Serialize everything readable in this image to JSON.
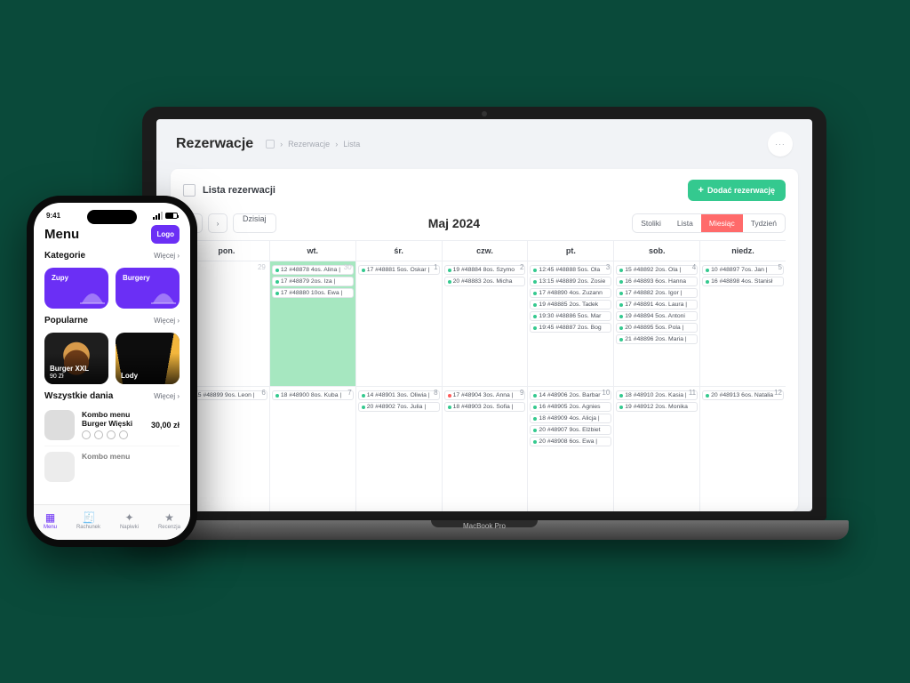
{
  "laptop_label": "MacBook Pro",
  "app": {
    "title": "Rezerwacje",
    "breadcrumbs": [
      "Rezerwacje",
      "Lista"
    ],
    "kebab": "···",
    "panel_title": "Lista rezerwacji",
    "add_button": "Dodać rezerwację",
    "today_button": "Dzisiaj",
    "month_label": "Maj 2024",
    "views": [
      "Stoliki",
      "Lista",
      "Miesiąc",
      "Tydzień"
    ],
    "active_view_index": 2,
    "weekdays": [
      "pon.",
      "wt.",
      "śr.",
      "czw.",
      "pt.",
      "sob.",
      "niedz."
    ],
    "rows": [
      [
        {
          "n": "29",
          "muted": true,
          "today": false,
          "events": []
        },
        {
          "n": "30",
          "muted": true,
          "today": true,
          "events": [
            {
              "t": "12 #48878 4os. Alina |"
            },
            {
              "t": "17 #48879 2os. Iza |"
            },
            {
              "t": "17 #48880 10os. Ewa |"
            }
          ]
        },
        {
          "n": "1",
          "events": [
            {
              "t": "17 #48881 5os. Oskar |"
            }
          ]
        },
        {
          "n": "2",
          "events": [
            {
              "t": "19 #48884 8os. Szymo"
            },
            {
              "t": "20 #48883 2os. Micha"
            }
          ]
        },
        {
          "n": "3",
          "events": [
            {
              "t": "12:45 #48888 5os. Ola"
            },
            {
              "t": "13:15 #48889 2os. Zosie"
            },
            {
              "t": "17 #48890 4os. Zuzann"
            },
            {
              "t": "19 #48885 2os. Tadek"
            },
            {
              "t": "19:30 #48886 5os. Mar"
            },
            {
              "t": "19:45 #48887 2os. Bog"
            }
          ]
        },
        {
          "n": "4",
          "events": [
            {
              "t": "15 #48892 2os. Ola |"
            },
            {
              "t": "16 #48893 6os. Hanna"
            },
            {
              "t": "17 #48882 2os. Igor |"
            },
            {
              "t": "17 #48891 4os. Laura |"
            },
            {
              "t": "19 #48894 5os. Antoni"
            },
            {
              "t": "20 #48895 5os. Pola |"
            },
            {
              "t": "21 #48896 2os. Maria |"
            }
          ]
        },
        {
          "n": "5",
          "events": [
            {
              "t": "10 #48897 7os. Jan |"
            },
            {
              "t": "16 #48898 4os. Stanisł"
            }
          ]
        }
      ],
      [
        {
          "n": "6",
          "events": [
            {
              "t": "15 #48899 9os. Leon |"
            }
          ]
        },
        {
          "n": "7",
          "events": [
            {
              "t": "18 #48900 8os. Kuba |"
            }
          ]
        },
        {
          "n": "8",
          "events": [
            {
              "t": "14 #48901 3os. Oliwia |"
            },
            {
              "t": "20 #48902 7os. Julia |"
            }
          ]
        },
        {
          "n": "9",
          "events": [
            {
              "t": "17 #48904 3os. Anna |",
              "red": true
            },
            {
              "t": "18 #48903 2os. Sofia |"
            }
          ]
        },
        {
          "n": "10",
          "events": [
            {
              "t": "14 #48906 2os. Barbar"
            },
            {
              "t": "16 #48905 2os. Agnies"
            },
            {
              "t": "18 #48909 4os. Alicja |"
            },
            {
              "t": "20 #48907 9os. Elżbiet"
            },
            {
              "t": "20 #48908 6os. Ewa |"
            }
          ]
        },
        {
          "n": "11",
          "events": [
            {
              "t": "18 #48910 2os. Kasia |"
            },
            {
              "t": "19 #48912 2os. Monika"
            }
          ]
        },
        {
          "n": "12",
          "events": [
            {
              "t": "20 #48913 6os. Natalia"
            }
          ]
        }
      ]
    ]
  },
  "phone": {
    "time": "9:41",
    "title": "Menu",
    "logo": "Logo",
    "more": "Więcej",
    "sec_categories": "Kategorie",
    "sec_popular": "Popularne",
    "sec_all": "Wszystkie dania",
    "categories": [
      "Zupy",
      "Burgery"
    ],
    "popular": [
      {
        "name": "Burger XXL",
        "price": "90 Zł"
      },
      {
        "name": "Lody",
        "price": ""
      }
    ],
    "dishes": [
      {
        "name": "Kombo menu Burger Więski",
        "price": "30,00 zł"
      },
      {
        "name": "Kombo menu",
        "price": ""
      }
    ],
    "tabs": [
      "Menu",
      "Rachunek",
      "Napiwki",
      "Recenzja"
    ],
    "active_tab_index": 0
  }
}
